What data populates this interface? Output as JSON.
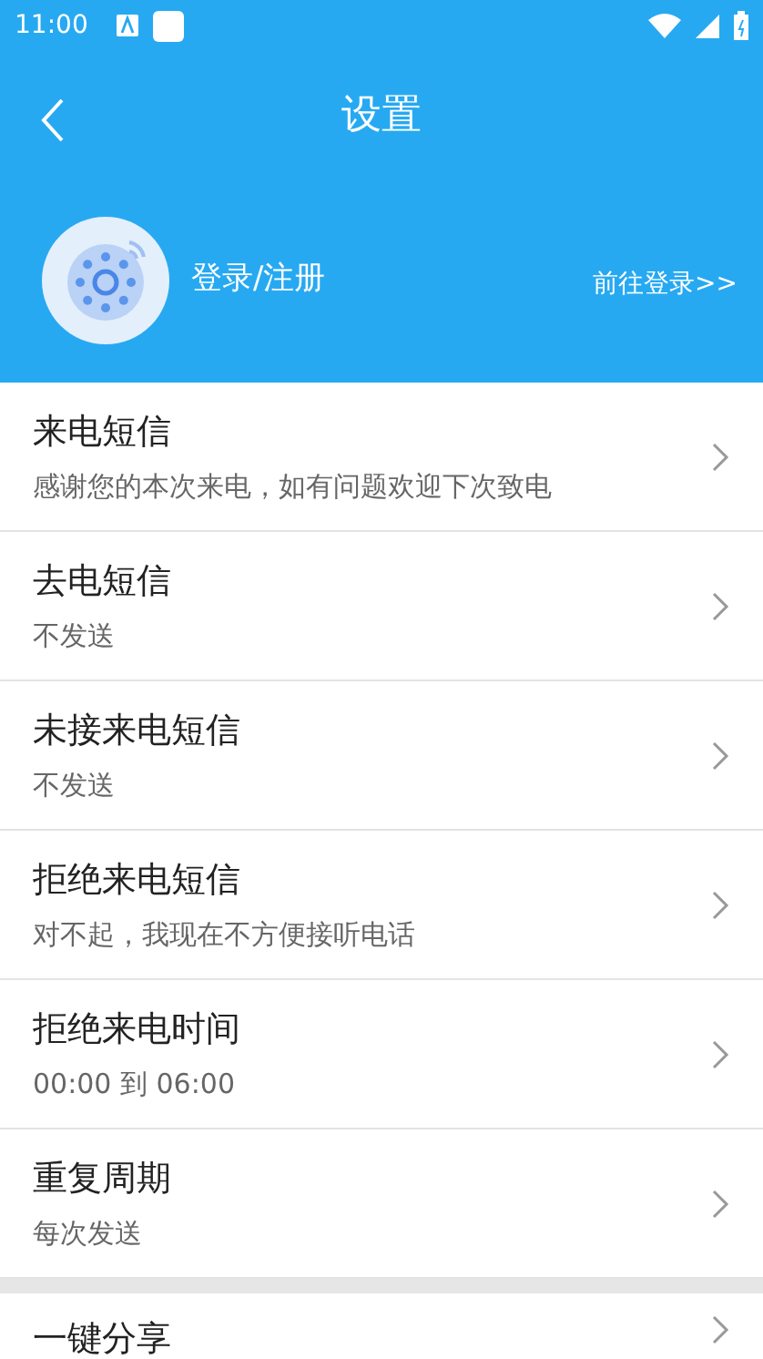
{
  "status_bar": {
    "time": "11:00"
  },
  "toolbar": {
    "title": "设置"
  },
  "profile": {
    "name": "登录/注册",
    "login_link": "前往登录>>"
  },
  "settings": [
    {
      "title": "来电短信",
      "value": "感谢您的本次来电，如有问题欢迎下次致电"
    },
    {
      "title": "去电短信",
      "value": "不发送"
    },
    {
      "title": "未接来电短信",
      "value": "不发送"
    },
    {
      "title": "拒绝来电短信",
      "value": "对不起，我现在不方便接听电话"
    },
    {
      "title": "拒绝来电时间",
      "value": "00:00 到 06:00"
    },
    {
      "title": "重复周期",
      "value": "每次发送"
    }
  ],
  "more": [
    {
      "title": "一键分享"
    }
  ]
}
